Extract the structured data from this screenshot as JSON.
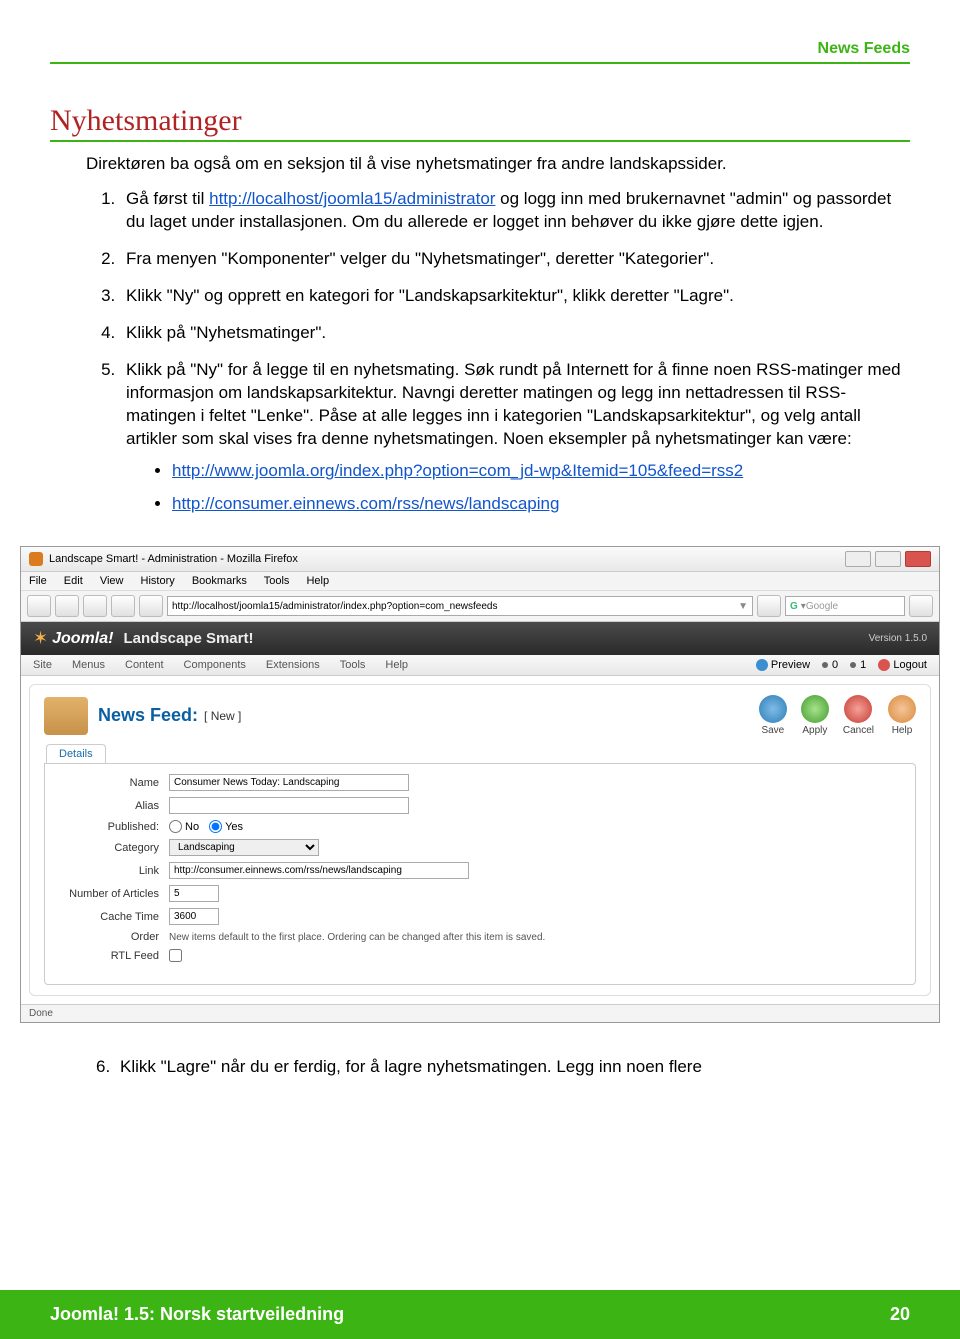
{
  "header": {
    "tag": "News Feeds"
  },
  "title": "Nyhetsmatinger",
  "intro": "Direktøren ba også om en seksjon til å vise nyhetsmatinger fra andre landskapssider.",
  "steps": {
    "s1a": "Gå først til ",
    "s1link": "http://localhost/joomla15/administrator",
    "s1b": " og logg inn med brukernavnet \"admin\" og passordet du laget under installasjonen. Om du allerede er logget inn behøver du ikke gjøre dette igjen.",
    "s2": "Fra menyen \"Komponenter\" velger du \"Nyhetsmatinger\", deretter \"Kategorier\".",
    "s3": "Klikk \"Ny\" og opprett en kategori for \"Landskapsarkitektur\", klikk deretter \"Lagre\".",
    "s4": "Klikk på \"Nyhetsmatinger\".",
    "s5": "Klikk på \"Ny\" for å legge til en nyhetsmating. Søk rundt på Internett for å finne noen RSS-matinger med informasjon om landskapsarkitektur. Navngi deretter matingen og legg inn nettadressen til RSS-matingen i feltet \"Lenke\". Påse at alle legges inn i kategorien \"Landskapsarkitektur\", og velg antall artikler som skal vises fra denne nyhetsmatingen. Noen eksempler på nyhetsmatinger kan være:",
    "link1": "http://www.joomla.org/index.php?option=com_jd-wp&Itemid=105&feed=rss2",
    "link2": "http://consumer.einnews.com/rss/news/landscaping",
    "s6": "Klikk \"Lagre\" når du er ferdig, for å lagre nyhetsmatingen. Legg inn noen flere"
  },
  "firefox": {
    "title": "Landscape Smart! - Administration - Mozilla Firefox",
    "menu": {
      "file": "File",
      "edit": "Edit",
      "view": "View",
      "history": "History",
      "bookmarks": "Bookmarks",
      "tools": "Tools",
      "help": "Help"
    },
    "url": "http://localhost/joomla15/administrator/index.php?option=com_newsfeeds",
    "search_placeholder": "Google",
    "status": "Done"
  },
  "joomla": {
    "brand": "Joomla!",
    "site": "Landscape Smart!",
    "version": "Version 1.5.0",
    "menu": {
      "site": "Site",
      "menus": "Menus",
      "content": "Content",
      "components": "Components",
      "extensions": "Extensions",
      "tools": "Tools",
      "help": "Help"
    },
    "right": {
      "preview": "Preview",
      "msg": "0",
      "users": "1",
      "logout": "Logout"
    },
    "panel_title": "News Feed:",
    "panel_sub": "[ New ]",
    "tools": {
      "save": "Save",
      "apply": "Apply",
      "cancel": "Cancel",
      "help": "Help"
    },
    "tab": "Details",
    "form": {
      "name_label": "Name",
      "name_value": "Consumer News Today: Landscaping",
      "alias_label": "Alias",
      "alias_value": "",
      "published_label": "Published:",
      "no": "No",
      "yes": "Yes",
      "category_label": "Category",
      "category_value": "Landscaping",
      "link_label": "Link",
      "link_value": "http://consumer.einnews.com/rss/news/landscaping",
      "numart_label": "Number of Articles",
      "numart_value": "5",
      "cache_label": "Cache Time",
      "cache_value": "3600",
      "order_label": "Order",
      "order_value": "New items default to the first place. Ordering can be changed after this item is saved.",
      "rtl_label": "RTL Feed"
    }
  },
  "footer": {
    "title": "Joomla! 1.5: Norsk startveiledning",
    "page": "20"
  }
}
